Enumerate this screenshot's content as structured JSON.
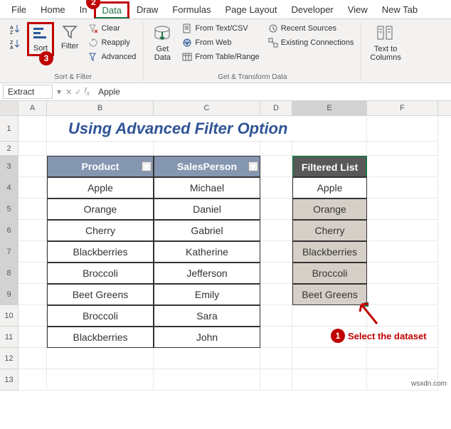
{
  "tabs": [
    "File",
    "Home",
    "In",
    "Data",
    "Draw",
    "Formulas",
    "Page Layout",
    "Developer",
    "View",
    "New Tab"
  ],
  "tab_active_index": 3,
  "badges": {
    "data": "2",
    "sort": "3",
    "select": "1"
  },
  "ribbon": {
    "sort_az": "A→Z",
    "sort_za": "Z→A",
    "sort": "Sort",
    "filter": "Filter",
    "clear": "Clear",
    "reapply": "Reapply",
    "advanced": "Advanced",
    "group1": "Sort & Filter",
    "getdata": "Get\nData",
    "fromtext": "From Text/CSV",
    "fromweb": "From Web",
    "fromtable": "From Table/Range",
    "recent": "Recent Sources",
    "existing": "Existing Connections",
    "group2": "Get & Transform Data",
    "texttocol": "Text to\nColumns"
  },
  "namebox": "Extract",
  "formula": "Apple",
  "cols": [
    "A",
    "B",
    "C",
    "D",
    "E",
    "F"
  ],
  "rows": [
    "1",
    "2",
    "3",
    "4",
    "5",
    "6",
    "7",
    "8",
    "9",
    "10",
    "11",
    "12",
    "13"
  ],
  "title": "Using Advanced Filter Option",
  "headers": {
    "product": "Product",
    "salesperson": "SalesPerson",
    "filtered": "Filtered List"
  },
  "table": [
    {
      "p": "Apple",
      "s": "Michael"
    },
    {
      "p": "Orange",
      "s": "Daniel"
    },
    {
      "p": "Cherry",
      "s": "Gabriel"
    },
    {
      "p": "Blackberries",
      "s": "Katherine"
    },
    {
      "p": "Broccoli",
      "s": "Jefferson"
    },
    {
      "p": "Beet Greens",
      "s": "Emily"
    },
    {
      "p": "Broccoli",
      "s": "Sara"
    },
    {
      "p": "Blackberries",
      "s": "John"
    }
  ],
  "filtered": [
    "Apple",
    "Orange",
    "Cherry",
    "Blackberries",
    "Broccoli",
    "Beet Greens"
  ],
  "annotation": "Select the dataset",
  "watermark": "wsxdn.com"
}
